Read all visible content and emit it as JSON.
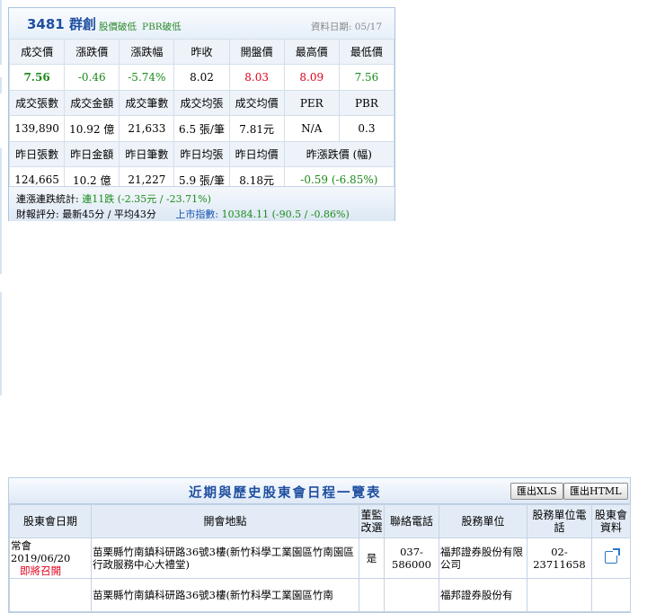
{
  "stock": {
    "code_name": "3481 群創",
    "tags": [
      "股價破低",
      "PBR破低"
    ],
    "date_label": "資料日期: 05/17"
  },
  "quote": {
    "row1_headers": [
      "成交價",
      "漲跌價",
      "漲跌幅",
      "昨收",
      "開盤價",
      "最高價",
      "最低價"
    ],
    "row1_values": [
      "7.56",
      "-0.46",
      "-5.74%",
      "8.02",
      "8.03",
      "8.09",
      "7.56"
    ],
    "row2_headers": [
      "成交張數",
      "成交金額",
      "成交筆數",
      "成交均張",
      "成交均價",
      "PER",
      "PBR"
    ],
    "row2_values": [
      "139,890",
      "10.92 億",
      "21,633",
      "6.5 張/筆",
      "7.81元",
      "N/A",
      "0.3"
    ],
    "row3_headers": [
      "昨日張數",
      "昨日金額",
      "昨日筆數",
      "昨日均張",
      "昨日均價",
      "昨漲跌價 (幅)"
    ],
    "row3_values": [
      "124,665",
      "10.2 億",
      "21,227",
      "5.9 張/筆",
      "8.18元",
      "-0.59 (-6.85%)"
    ]
  },
  "summary": {
    "streak_label": "連漲連跌統計:",
    "streak_value": "連11跌",
    "streak_detail": "(-2.35元 / -23.71%)",
    "rating_text": "財報評分: 最新45分 / 平均43分",
    "index_label": "上市指數:",
    "index_value": "10384.11 (-90.5 / -0.86%)"
  },
  "meetings": {
    "title": "近期與歷史股東會日程一覽表",
    "export_xls": "匯出XLS",
    "export_html": "匯出HTML",
    "headers": [
      "股東會日期",
      "開會地點",
      "董監改選",
      "聯絡電話",
      "股務單位",
      "股務單位電話",
      "股東會資料"
    ],
    "rows": [
      {
        "type": "常會",
        "date": "2019/06/20",
        "status": "即將召開",
        "location": "苗栗縣竹南鎮科研路36號3樓(新竹科學工業園區竹南園區行政服務中心大禮堂)",
        "election": "是",
        "phone": "037-586000",
        "agent": "福邦證券股份有限公司",
        "agent_phone": "02-23711658"
      },
      {
        "type": "",
        "date": "",
        "status": "",
        "location": "苗栗縣竹南鎮科研路36號3樓(新竹科學工業園區竹南",
        "election": "",
        "phone": "",
        "agent": "福邦證券股份有",
        "agent_phone": ""
      }
    ]
  },
  "colors": {
    "up": "#e0001b",
    "down": "#1b8a1b",
    "link": "#1a55b5",
    "header_bg": "#eef3f9"
  }
}
